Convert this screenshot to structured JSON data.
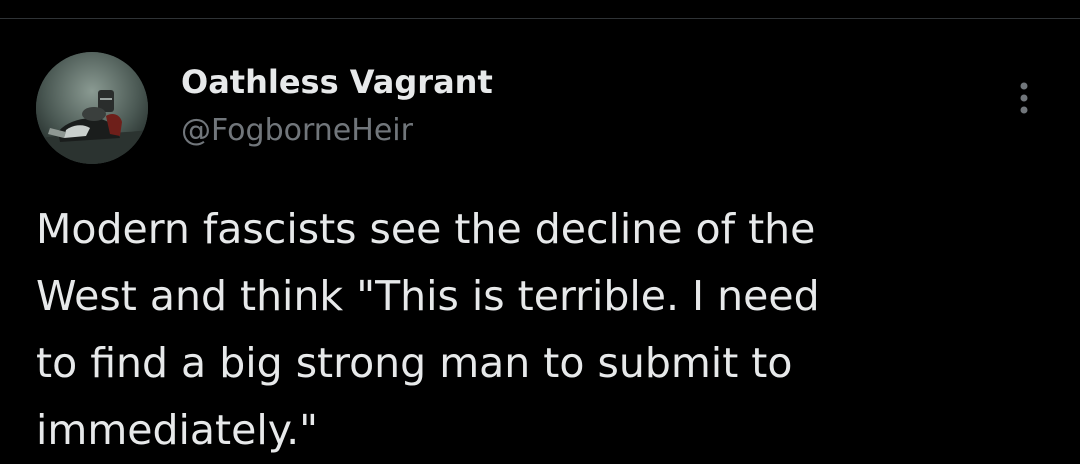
{
  "tweet": {
    "author": {
      "display_name": "Oathless Vagrant",
      "handle": "@FogborneHeir",
      "avatar_icon": "armored-knight-avatar"
    },
    "text": "Modern fascists see the decline of the\nWest and think \"This is terrible. I need\nto find a big strong man to submit to\nimmediately.\"",
    "more_icon": "more-vertical-icon"
  },
  "colors": {
    "background": "#000000",
    "primary_text": "#e7e9ea",
    "secondary_text": "#71767b",
    "divider": "#2f3336"
  }
}
